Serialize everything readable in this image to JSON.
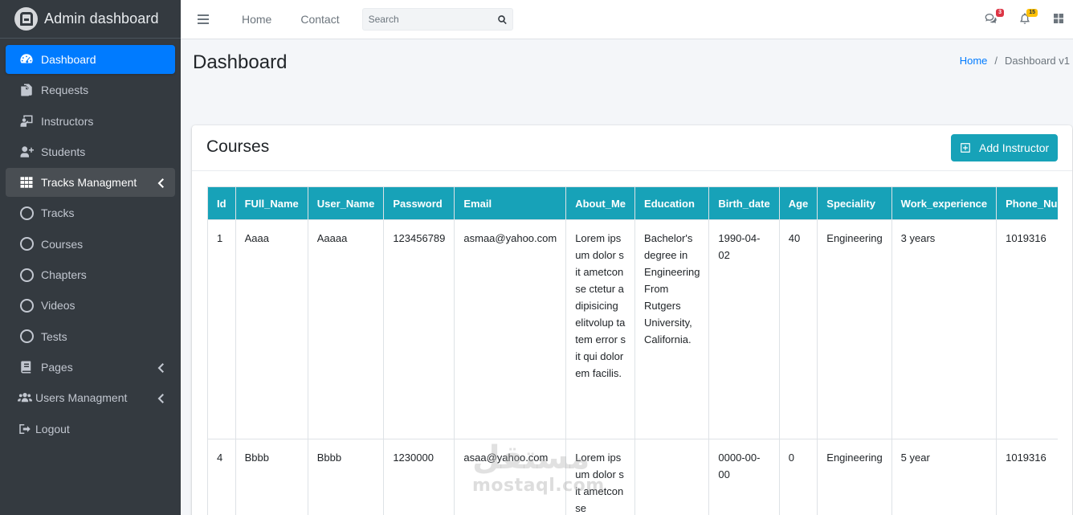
{
  "brand": {
    "title": "Admin dashboard"
  },
  "sidebar": {
    "items": [
      {
        "label": "Dashboard",
        "icon": "tachometer-icon",
        "state": "active"
      },
      {
        "label": "Requests",
        "icon": "copy-icon"
      },
      {
        "label": "Instructors",
        "icon": "chalkboard-teacher-icon"
      },
      {
        "label": "Students",
        "icon": "user-plus-icon"
      },
      {
        "label": "Tracks Managment",
        "icon": "th-icon",
        "state": "open",
        "arrow": true
      },
      {
        "label": "Tracks",
        "icon": "circle-icon"
      },
      {
        "label": "Courses",
        "icon": "circle-icon"
      },
      {
        "label": "Chapters",
        "icon": "circle-icon"
      },
      {
        "label": "Videos",
        "icon": "circle-icon"
      },
      {
        "label": "Tests",
        "icon": "circle-icon"
      },
      {
        "label": "Pages",
        "icon": "book-icon",
        "arrow": true
      },
      {
        "label": "Users Managment",
        "icon": "users-icon",
        "arrow": true
      },
      {
        "label": "Logout",
        "icon": "sign-out-icon"
      }
    ]
  },
  "topbar": {
    "links": [
      "Home",
      "Contact"
    ],
    "search_placeholder": "Search",
    "messages_badge": "3",
    "notifications_badge": "15"
  },
  "content": {
    "title": "Dashboard",
    "breadcrumb": {
      "home": "Home",
      "separator": "/",
      "current": "Dashboard v1"
    }
  },
  "card": {
    "title": "Courses",
    "add_button": "Add Instructor",
    "columns": [
      "Id",
      "FUll_Name",
      "User_Name",
      "Password",
      "Email",
      "About_Me",
      "Education",
      "Birth_date",
      "Age",
      "Speciality",
      "Work_experience",
      "Phone_Number"
    ],
    "rows": [
      {
        "id": "1",
        "full_name": "Aaaa",
        "user_name": "Aaaaa",
        "password": "123456789",
        "email": "asmaa@yahoo.com",
        "about_me": "Lorem ipsum dolor sit ametconse ctetur adipisicing elitvolup tatem error sit qui dolorem facilis.",
        "education": "Bachelor's degree in Engineering From Rutgers University, California.",
        "birth_date": "1990-04-02",
        "age": "40",
        "speciality": "Engineering",
        "work_experience": "3 years",
        "phone": "1019316"
      },
      {
        "id": "4",
        "full_name": "Bbbb",
        "user_name": "Bbbb",
        "password": "1230000",
        "email": "asaa@yahoo.com",
        "about_me": "Lorem ipsum dolor sit ametconse",
        "education": "",
        "birth_date": "0000-00-00",
        "age": "0",
        "speciality": "Engineering",
        "work_experience": "5 year",
        "phone": "1019316"
      }
    ]
  },
  "watermark": {
    "arabic": "مستقل",
    "latin": "mostaql.com"
  },
  "colors": {
    "sidebar": "#343a40",
    "primary": "#007bff",
    "info": "#17a2b8",
    "danger": "#dc3545",
    "warning": "#ffc107"
  }
}
